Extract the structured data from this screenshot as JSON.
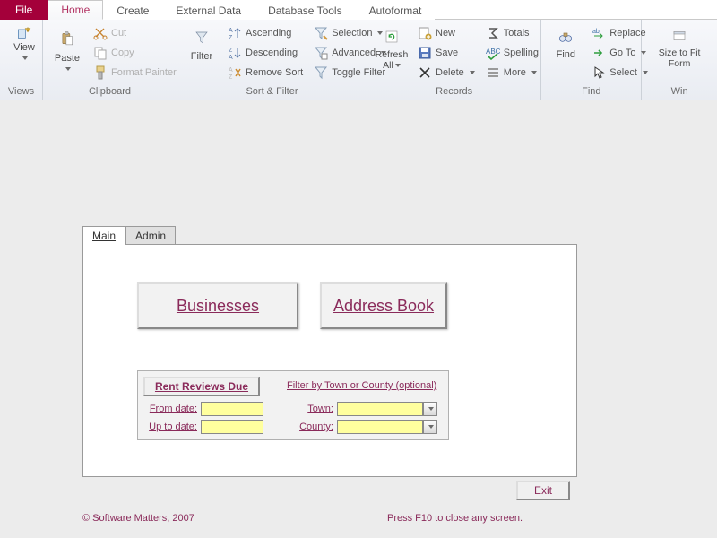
{
  "menu": {
    "file": "File",
    "items": [
      "Home",
      "Create",
      "External Data",
      "Database Tools",
      "Autoformat"
    ],
    "active_index": 0
  },
  "ribbon": {
    "views": {
      "view": "View",
      "group": "Views"
    },
    "clipboard": {
      "paste": "Paste",
      "cut": "Cut",
      "copy": "Copy",
      "format_painter": "Format Painter",
      "group": "Clipboard"
    },
    "sortfilter": {
      "filter": "Filter",
      "ascending": "Ascending",
      "descending": "Descending",
      "remove_sort": "Remove Sort",
      "selection": "Selection",
      "advanced": "Advanced",
      "toggle_filter": "Toggle Filter",
      "group": "Sort & Filter"
    },
    "records": {
      "refresh_all": "Refresh All",
      "new": "New",
      "save": "Save",
      "delete": "Delete",
      "totals": "Totals",
      "spelling": "Spelling",
      "more": "More",
      "group": "Records"
    },
    "find": {
      "find": "Find",
      "replace": "Replace",
      "goto": "Go To",
      "select": "Select",
      "group": "Find"
    },
    "window": {
      "size_to_fit": "Size to Fit Form",
      "group": "Win"
    }
  },
  "form": {
    "tabs": [
      "Main",
      "Admin"
    ],
    "active_tab_index": 0,
    "businesses_btn": "Businesses",
    "address_book_btn": "Address Book",
    "rent_reviews_btn": "Rent Reviews Due",
    "filter_link": "Filter by Town or County (optional)",
    "from_date_label": "From date:",
    "up_to_date_label": "Up to date:",
    "town_label": "Town:",
    "county_label": "County:",
    "from_date_value": "",
    "up_to_date_value": "",
    "town_value": "",
    "county_value": "",
    "exit_btn": "Exit",
    "footer_left": "© Software Matters,  2007",
    "footer_right": "Press F10 to close any screen."
  }
}
